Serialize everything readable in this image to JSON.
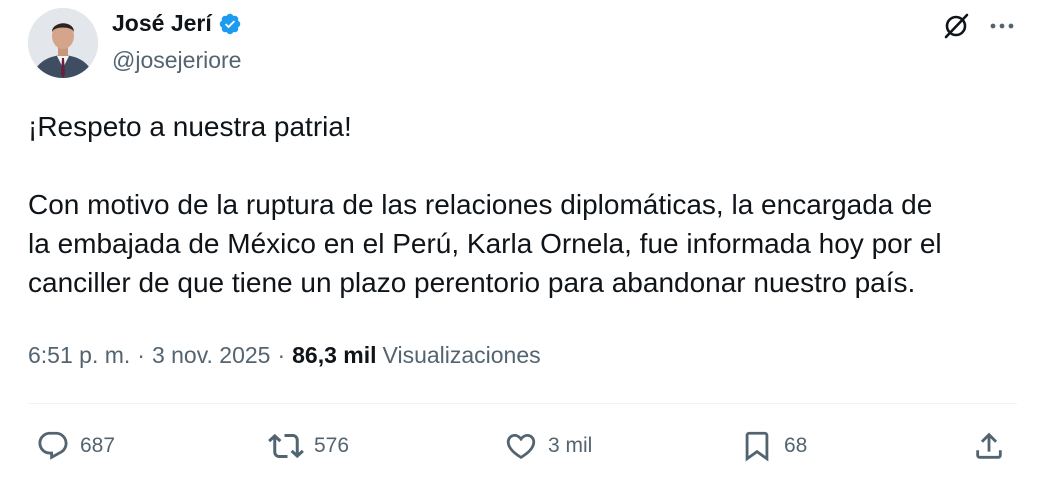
{
  "author": {
    "name": "José Jerí",
    "handle": "@josejeriore"
  },
  "tweet": {
    "lines_p1": [
      "¡Respeto a nuestra patria!"
    ],
    "lines_p2": [
      "Con motivo de la ruptura de las relaciones diplomáticas, la encargada de",
      "la embajada de México en el Perú, Karla Ornela, fue informada hoy por el",
      "canciller de que tiene un plazo perentorio para abandonar nuestro país."
    ]
  },
  "meta": {
    "time": "6:51 p. m.",
    "separator": "·",
    "date": "3 nov. 2025",
    "views_count": "86,3 mil",
    "views_label": "Visualizaciones"
  },
  "actions": {
    "replies": "687",
    "reposts": "576",
    "likes": "3 mil",
    "bookmarks": "68"
  },
  "icons": {
    "verified": "verified-badge-icon",
    "grok": "grok-icon",
    "more": "more-options-icon",
    "reply": "reply-icon",
    "repost": "repost-icon",
    "like": "heart-icon",
    "bookmark": "bookmark-icon",
    "share": "share-icon"
  },
  "colors": {
    "text": "#0f1419",
    "secondary": "#536471",
    "verified": "#1d9bf0",
    "divider": "#eff3f4"
  }
}
